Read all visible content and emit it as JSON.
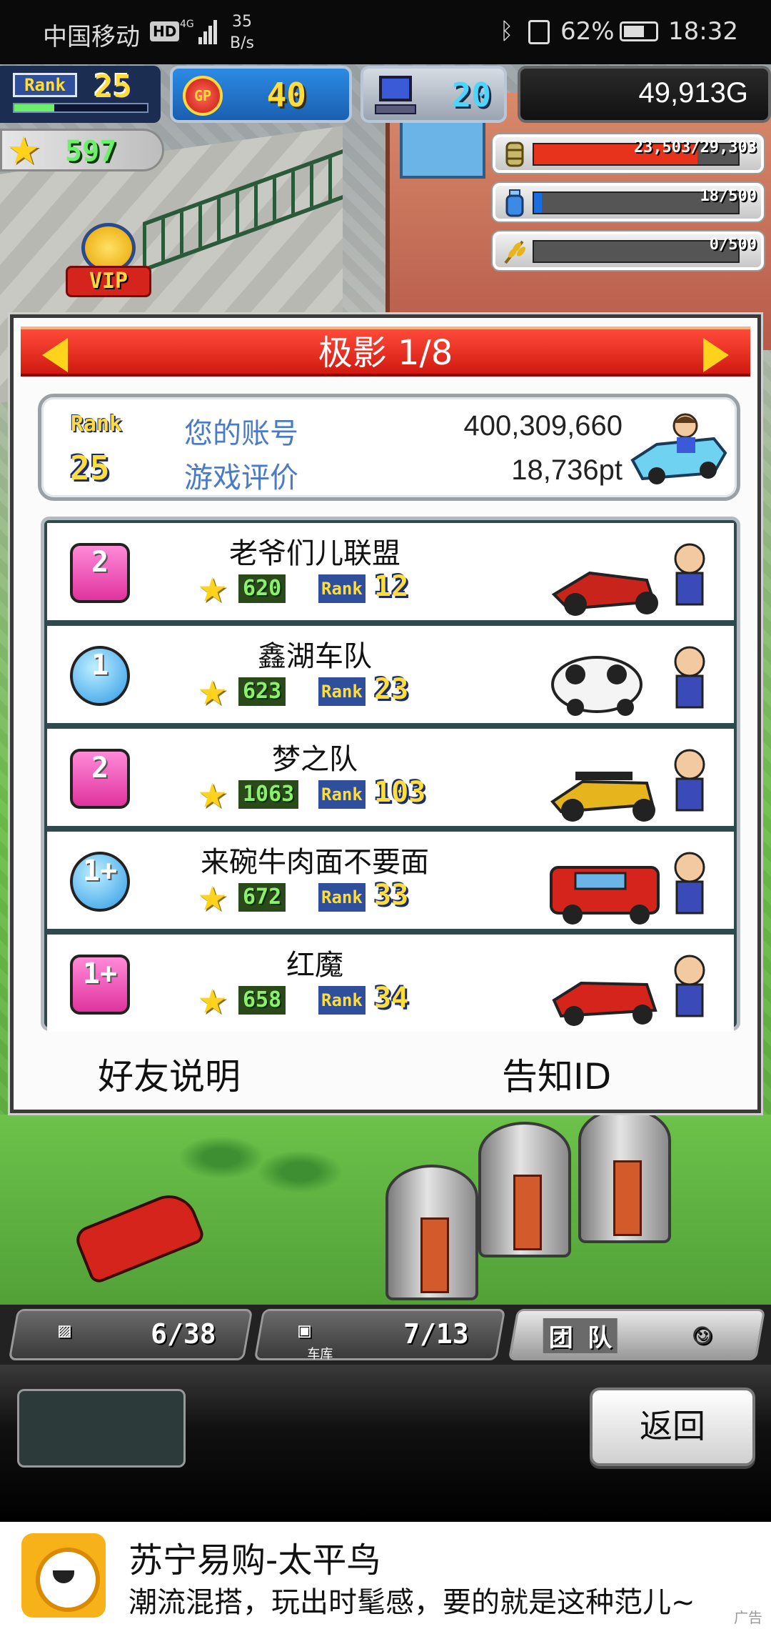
{
  "status_bar": {
    "carrier": "中国移动",
    "hd": "HD",
    "network": "4G",
    "speed_value": "35",
    "speed_unit": "B/s",
    "battery": "62%",
    "time": "18:32"
  },
  "hud": {
    "rank_label": "Rank",
    "rank": "25",
    "gp_label": "GP",
    "gp": "40",
    "pc": "20",
    "money": "49,913G",
    "stars": "597"
  },
  "resources": [
    {
      "name": "fuel",
      "text": "23,503/29,303",
      "fraction": 0.8,
      "color": "#e8331c"
    },
    {
      "name": "water",
      "text": "18/500",
      "fraction": 0.04,
      "color": "#1a6ee0"
    },
    {
      "name": "grain",
      "text": "0/500",
      "fraction": 0.0,
      "color": "#e6b41c"
    }
  ],
  "vip_label": "VIP",
  "dialog": {
    "title": "极影 1/8",
    "account": {
      "rank_label": "Rank",
      "rank": "25",
      "id_label": "您的账号",
      "id_value": "400,309,660",
      "rating_label": "游戏评价",
      "rating_value": "18,736pt"
    },
    "teams": [
      {
        "name": "老爷们儿联盟",
        "level": "2",
        "badge": "square",
        "points": "620",
        "rank_label": "Rank",
        "rank": "12"
      },
      {
        "name": "鑫湖车队",
        "level": "1",
        "badge": "circle",
        "points": "623",
        "rank_label": "Rank",
        "rank": "23"
      },
      {
        "name": "梦之队",
        "level": "2",
        "badge": "square",
        "points": "1063",
        "rank_label": "Rank",
        "rank": "103"
      },
      {
        "name": "来碗牛肉面不要面",
        "level": "1+",
        "badge": "circle",
        "points": "672",
        "rank_label": "Rank",
        "rank": "33"
      },
      {
        "name": "红魔",
        "level": "1+",
        "badge": "square",
        "points": "658",
        "rank_label": "Rank",
        "rank": "34"
      }
    ],
    "footer": {
      "friends_help": "好友说明",
      "notify_id": "告知ID"
    }
  },
  "dock": {
    "storage": "6/38",
    "garage_label": "车库",
    "garage": "7/13",
    "team_label": "团 队"
  },
  "back_label": "返回",
  "ad": {
    "title": "苏宁易购-太平鸟",
    "text": "潮流混搭，玩出时髦感，要的就是这种范儿~",
    "tag": "广告"
  }
}
